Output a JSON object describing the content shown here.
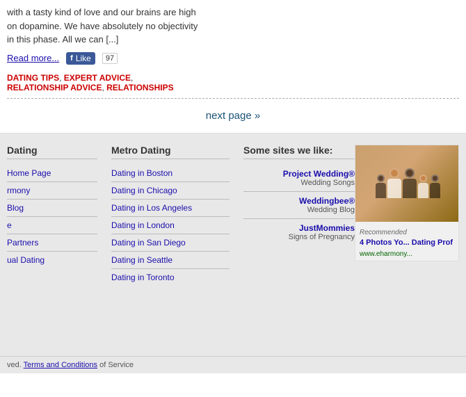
{
  "article": {
    "text_line1": "with a tasty kind of love and our brains are high",
    "text_line2": "on dopamine. We have absolutely no objectivity",
    "text_line3": "in this phase. All we can [...]",
    "read_more_label": "Read more...",
    "fb_like_label": "Like",
    "fb_count": "97",
    "tags": [
      {
        "label": "DATING TIPS",
        "separator": ","
      },
      {
        "label": "EXPERT ADVICE",
        "separator": ","
      },
      {
        "label": "RELATIONSHIP ADVICE",
        "separator": ","
      },
      {
        "label": "RELATIONSHIPS",
        "separator": ""
      }
    ],
    "next_page_label": "next page »"
  },
  "sidebar": {
    "dating": {
      "heading": "Dating",
      "links": [
        {
          "label": "Home Page"
        },
        {
          "label": "rmony"
        },
        {
          "label": "Blog"
        },
        {
          "label": "e"
        },
        {
          "label": "Partners"
        },
        {
          "label": "ual Dating"
        }
      ]
    },
    "metro": {
      "heading": "Metro Dating",
      "links": [
        {
          "label": "Dating in Boston"
        },
        {
          "label": "Dating in Chicago"
        },
        {
          "label": "Dating in Los Angeles"
        },
        {
          "label": "Dating in London"
        },
        {
          "label": "Dating in San Diego"
        },
        {
          "label": "Dating in Seattle"
        },
        {
          "label": "Dating in Toronto"
        }
      ]
    },
    "sites": {
      "heading": "Some sites we like:",
      "items": [
        {
          "name": "Project Wedding®",
          "sub": "Wedding Songs"
        },
        {
          "name": "Weddingbee®",
          "sub": "Wedding Blog"
        },
        {
          "name": "JustMommies",
          "sub": "Signs of Pregnancy"
        }
      ]
    },
    "ad": {
      "recommended_label": "Recommended",
      "title": "4 Photos Yo... Dating Prof",
      "url": "www.eharmony..."
    }
  },
  "footer": {
    "copyright_text": "ved.",
    "terms_label": "Terms and Conditions",
    "service_text": "of Service"
  }
}
